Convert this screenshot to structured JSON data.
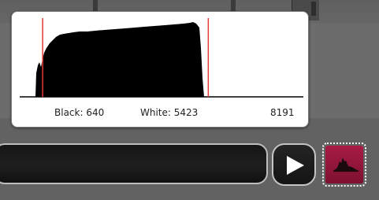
{
  "histogram": {
    "black_label": "Black: 640",
    "white_label": "White: 5423",
    "max_label": "8191",
    "black_point": 640,
    "white_point": 5423,
    "max_value": 8191,
    "black_marker_color": "#e53935",
    "white_marker_color": "#e53935"
  },
  "controls": {
    "play_icon": "play-icon",
    "histogram_icon": "histogram-icon",
    "histogram_button_color": "#a81c45"
  }
}
